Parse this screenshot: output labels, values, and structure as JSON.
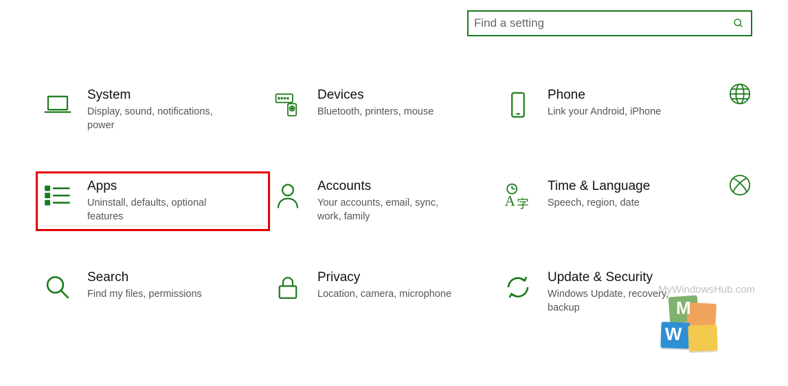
{
  "search": {
    "placeholder": "Find a setting"
  },
  "tiles": {
    "system": {
      "title": "System",
      "desc": "Display, sound, notifications, power"
    },
    "devices": {
      "title": "Devices",
      "desc": "Bluetooth, printers, mouse"
    },
    "phone": {
      "title": "Phone",
      "desc": "Link your Android, iPhone"
    },
    "apps": {
      "title": "Apps",
      "desc": "Uninstall, defaults, optional features"
    },
    "accounts": {
      "title": "Accounts",
      "desc": "Your accounts, email, sync, work, family"
    },
    "time": {
      "title": "Time & Language",
      "desc": "Speech, region, date"
    },
    "search": {
      "title": "Search",
      "desc": "Find my files, permissions"
    },
    "privacy": {
      "title": "Privacy",
      "desc": "Location, camera, microphone"
    },
    "update": {
      "title": "Update & Security",
      "desc": "Windows Update, recovery, backup"
    }
  },
  "watermark": "MyWindowsHub.com",
  "colors": {
    "accent": "#1a7a1a",
    "highlight": "#e60000"
  }
}
